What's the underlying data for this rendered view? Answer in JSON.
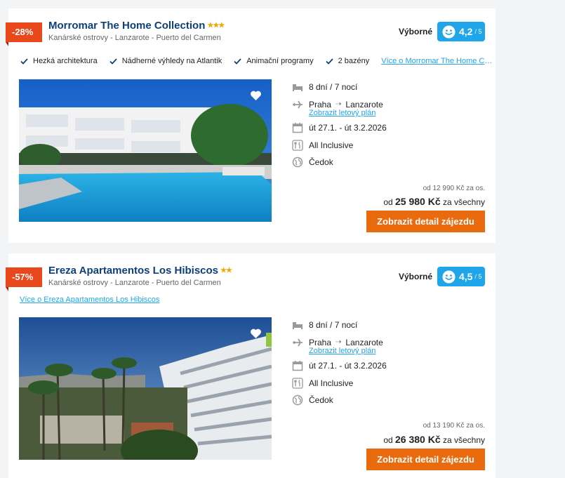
{
  "colors": {
    "accent": "#1fa6ea",
    "cta": "#ea6a0e",
    "discount": "#e8481c",
    "title": "#0d3f7a",
    "stars": "#f0a800"
  },
  "cards": [
    {
      "discount": "-28%",
      "title": "Morromar The Home Collection",
      "stars": "★★★",
      "location": "Kanárské ostrovy - Lanzarote - Puerto del Carmen",
      "rating_word": "Výborné",
      "rating_value": "4,2",
      "rating_max": "/ 5",
      "features": [
        "Hezká architektura",
        "Nádherné výhledy na Atlantik",
        "Animační programy",
        "2 bazény"
      ],
      "more_link": "Více o Morromar The Home Collection",
      "image_icon": "hotel-pool-photo",
      "duration": "8 dní / 7 nocí",
      "from": "Praha",
      "to": "Lanzarote",
      "flight_plan_link": "Zobrazit letový plán",
      "dates": "út 27.1. - út 3.2.2026",
      "board": "All Inclusive",
      "operator": "Čedok",
      "price_per_person": "od 12 990 Kč za os.",
      "price_total_prefix": "od",
      "price_total_value": "25 980 Kč",
      "price_total_suffix": "za všechny",
      "cta": "Zobrazit detail zájezdu"
    },
    {
      "discount": "-57%",
      "title": "Ereza Apartamentos Los Hibiscos",
      "stars": "★★",
      "location": "Kanárské ostrovy - Lanzarote - Puerto del Carmen",
      "rating_word": "Výborné",
      "rating_value": "4,5",
      "rating_max": "/ 5",
      "more_link": "Více o Ereza Apartamentos Los Hibiscos",
      "image_icon": "apartment-building-photo",
      "duration": "8 dní / 7 nocí",
      "from": "Praha",
      "to": "Lanzarote",
      "flight_plan_link": "Zobrazit letový plán",
      "dates": "út 27.1. - út 3.2.2026",
      "board": "All Inclusive",
      "operator": "Čedok",
      "price_per_person": "od 13 190 Kč za os.",
      "price_total_prefix": "od",
      "price_total_value": "26 380 Kč",
      "price_total_suffix": "za všechny",
      "cta": "Zobrazit detail zájezdu"
    }
  ]
}
